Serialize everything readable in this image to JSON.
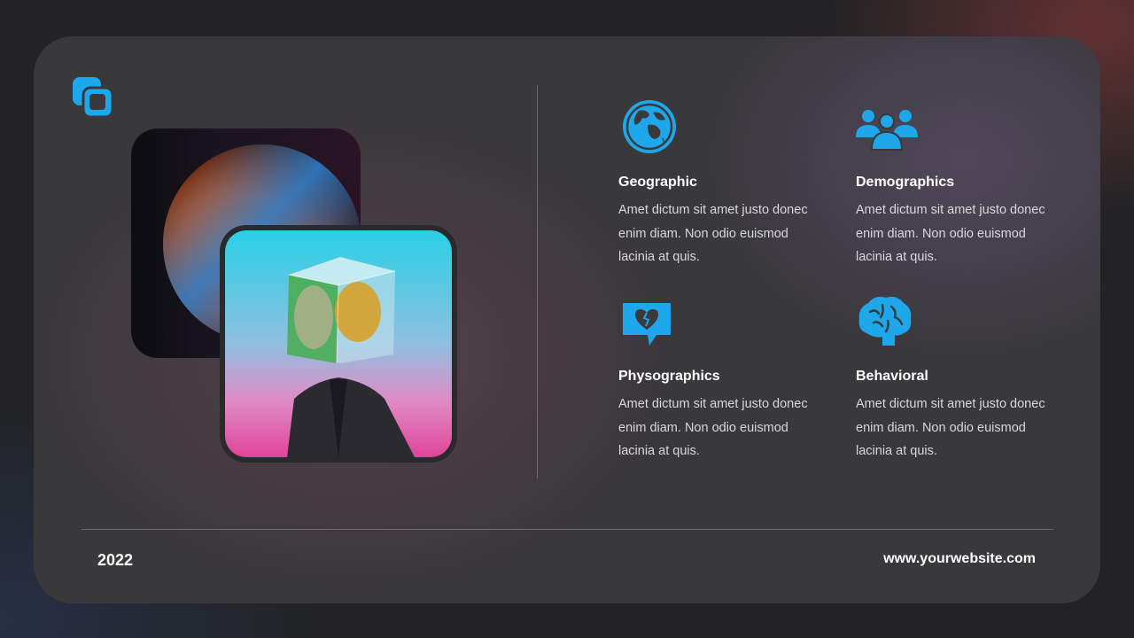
{
  "colors": {
    "accent": "#1ea7ea",
    "card": "#39383b",
    "background": "#232325"
  },
  "icons": {
    "logo": "overlapping-squares-icon"
  },
  "features": [
    {
      "icon": "globe-icon",
      "title": "Geographic",
      "description": "Amet dictum sit amet justo donec enim diam. Non odio euismod lacinia at quis."
    },
    {
      "icon": "users-group-icon",
      "title": "Demographics",
      "description": "Amet dictum sit amet justo donec enim diam. Non odio euismod lacinia at quis."
    },
    {
      "icon": "broken-heart-chat-icon",
      "title": "Physographics",
      "description": "Amet dictum sit amet justo donec enim diam. Non odio euismod lacinia at quis."
    },
    {
      "icon": "brain-icon",
      "title": "Behavioral",
      "description": "Amet dictum sit amet justo donec enim diam. Non odio euismod lacinia at quis."
    }
  ],
  "footer": {
    "year": "2022",
    "website": "www.yourwebsite.com"
  }
}
